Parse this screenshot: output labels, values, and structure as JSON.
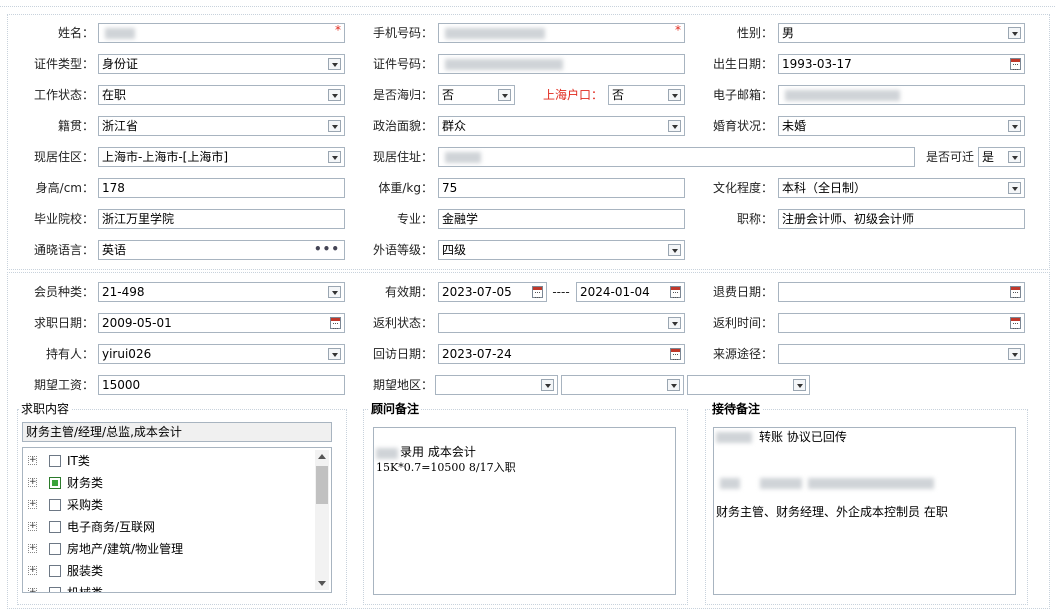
{
  "personal": {
    "name_label": "姓名：",
    "required_mark": "*",
    "phone_label": "手机号码：",
    "gender_label": "性别：",
    "gender_value": "男",
    "id_type_label": "证件类型：",
    "id_type_value": "身份证",
    "id_number_label": "证件号码：",
    "birth_label": "出生日期：",
    "birth_value": "1993-03-17",
    "work_status_label": "工作状态：",
    "work_status_value": "在职",
    "overseas_label": "是否海归：",
    "overseas_value": "否",
    "shanghai_hukou_label": "上海户口：",
    "shanghai_hukou_value": "否",
    "email_label": "电子邮箱：",
    "origin_label": "籍贯：",
    "origin_value": "浙江省",
    "political_label": "政治面貌：",
    "political_value": "群众",
    "marital_label": "婚育状况：",
    "marital_value": "未婚",
    "residence_area_label": "现居住区：",
    "residence_area_value": "上海市-上海市-[上海市]",
    "address_label": "现居住址：",
    "relocate_label": "是否可迁",
    "relocate_value": "是",
    "height_label": "身高/cm：",
    "height_value": "178",
    "weight_label": "体重/kg：",
    "weight_value": "75",
    "education_label": "文化程度：",
    "education_value": "本科（全日制）",
    "school_label": "毕业院校：",
    "school_value": "浙江万里学院",
    "major_label": "专业：",
    "major_value": "金融学",
    "title_label": "职称：",
    "title_value": "注册会计师、初级会计师",
    "language_label": "通晓语言：",
    "language_value": "英语",
    "language_more": "•••",
    "lang_level_label": "外语等级：",
    "lang_level_value": "四级"
  },
  "membership": {
    "member_type_label": "会员种类：",
    "member_type_value": "21-498",
    "validity_label": "有效期：",
    "validity_start": "2023-07-05",
    "validity_sep": "----",
    "validity_end": "2024-01-04",
    "refund_date_label": "退费日期：",
    "job_date_label": "求职日期：",
    "job_date_value": "2009-05-01",
    "rebate_status_label": "返利状态：",
    "rebate_time_label": "返利时间：",
    "holder_label": "持有人：",
    "holder_value": "yirui026",
    "visit_date_label": "回访日期：",
    "visit_date_value": "2023-07-24",
    "source_label": "来源途径：",
    "salary_label": "期望工资：",
    "salary_value": "15000",
    "region_label": "期望地区："
  },
  "job_content": {
    "legend": "求职内容",
    "summary": "财务主管/经理/总监,成本会计",
    "tree": [
      {
        "label": "IT类",
        "checked": false
      },
      {
        "label": "财务类",
        "checked": true
      },
      {
        "label": "采购类",
        "checked": false
      },
      {
        "label": "电子商务/互联网",
        "checked": false
      },
      {
        "label": "房地产/建筑/物业管理",
        "checked": false
      },
      {
        "label": "服装类",
        "checked": false
      },
      {
        "label": "机械类",
        "checked": false
      }
    ]
  },
  "consultant_note": {
    "legend": "顾问备注",
    "line1": "录用 成本会计",
    "line2": "15K*0.7=10500  8/17入职"
  },
  "reception_note": {
    "legend": "接待备注",
    "line1": "转账  协议已回传",
    "line3": "财务主管、财务经理、外企成本控制员 在职"
  }
}
